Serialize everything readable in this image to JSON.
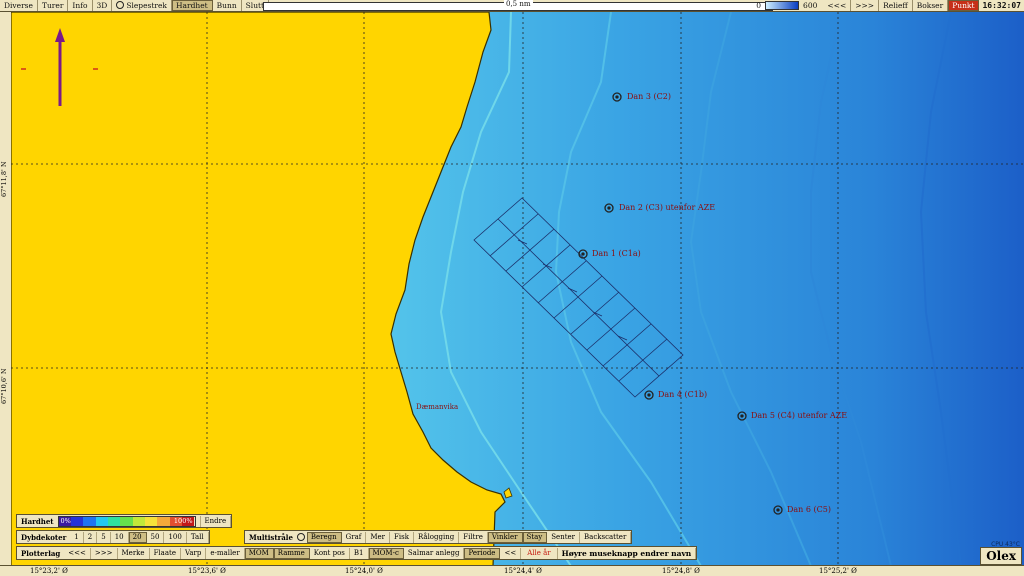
{
  "toolbar": {
    "left": [
      {
        "label": "Diverse"
      },
      {
        "label": "Turer"
      },
      {
        "label": "Info"
      },
      {
        "label": "3D"
      },
      {
        "label": "Slepestrek",
        "radio": true
      },
      {
        "label": "Hardhet",
        "active": true
      },
      {
        "label": "Bunn"
      },
      {
        "label": "Slutt"
      }
    ],
    "scale_label": "0,5 nm",
    "depth_min": "0",
    "depth_max": "600",
    "right": [
      {
        "label": "<<<"
      },
      {
        "label": ">>>"
      },
      {
        "label": "Relieff"
      },
      {
        "label": "Bokser"
      },
      {
        "label": "Punkt",
        "active": true,
        "color": "#c63018"
      }
    ],
    "clock": "16:32:07"
  },
  "map": {
    "place_name": "Dæmanvika",
    "waypoints": [
      {
        "label": "Dan 3 (C2)"
      },
      {
        "label": "Dan 2 (C3) utenfor AZE"
      },
      {
        "label": "Dan 1 (C1a)"
      },
      {
        "label": "Dan 4 (C1b)"
      },
      {
        "label": "Dan 5 (C4) utenfor AZE"
      },
      {
        "label": "Dan 6 (C5)"
      }
    ],
    "lat_labels": [
      "67°11,8' N",
      "67°10,6' N"
    ],
    "lon_labels": [
      "15°23,2' Ø",
      "15°23,6' Ø",
      "15°24,0' Ø",
      "15°24,4' Ø",
      "15°24,8' Ø",
      "15°25,2' Ø"
    ],
    "cpu_temp": "CPU 43°C",
    "colors": {
      "land": "#ffd500",
      "shallow": "#9ce9f1",
      "deep": "#1f6fd0",
      "waypoint_text": "#8b0d0d",
      "grid": "#222222"
    }
  },
  "hardhet_panel": {
    "title": "Hardhet",
    "low": "0%",
    "high": "100%",
    "button": "Endre",
    "colors": [
      "#3a1aa0",
      "#2533d8",
      "#1f74f2",
      "#23c8ef",
      "#2fe0a0",
      "#66e04d",
      "#c2e83a",
      "#f6e23a",
      "#f5a93a",
      "#e25030",
      "#c21818"
    ]
  },
  "dybdekoter": {
    "title": "Dybdekoter",
    "options": [
      {
        "label": "1"
      },
      {
        "label": "2"
      },
      {
        "label": "5"
      },
      {
        "label": "10"
      },
      {
        "label": "20",
        "active": true
      },
      {
        "label": "50"
      },
      {
        "label": "100"
      },
      {
        "label": "Tall"
      }
    ]
  },
  "multistraale": {
    "title": "Multistråle",
    "options": [
      {
        "label": "Beregn",
        "active": true,
        "radio": true
      },
      {
        "label": "Graf"
      },
      {
        "label": "Mer"
      },
      {
        "label": "Fisk"
      },
      {
        "label": "Rålogging"
      },
      {
        "label": "Filtre"
      },
      {
        "label": "Vinkler",
        "active": true
      },
      {
        "label": "Stay",
        "active": true
      },
      {
        "label": "Senter"
      },
      {
        "label": "Backscatter"
      }
    ]
  },
  "plotterlag": {
    "title": "Plotterlag",
    "options": [
      {
        "label": "<<<"
      },
      {
        "label": ">>>"
      },
      {
        "label": "Merke"
      },
      {
        "label": "Flaate"
      },
      {
        "label": "Varp"
      },
      {
        "label": "e-maller"
      },
      {
        "label": "MOM",
        "active": true
      },
      {
        "label": "Ramme",
        "active": true
      },
      {
        "label": "Kont pos"
      },
      {
        "label": "B1"
      },
      {
        "label": "MOM-c",
        "active": true
      },
      {
        "label": "Salmar anlegg"
      },
      {
        "label": "Periode",
        "active": true
      },
      {
        "label": "<<"
      },
      {
        "label": "Alle år",
        "highlight": true
      },
      {
        "label": "Høyre museknapp endrer navn"
      }
    ]
  },
  "brand": "Olex"
}
